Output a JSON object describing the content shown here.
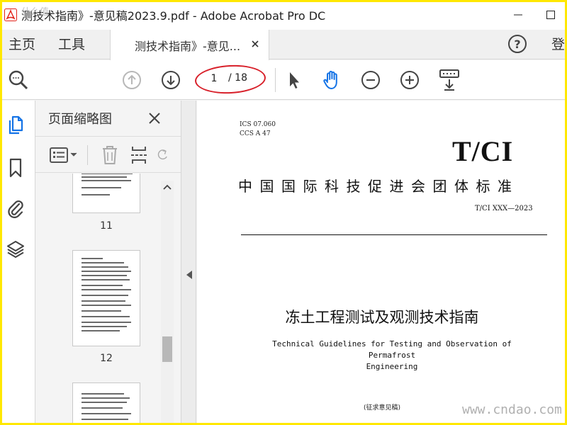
{
  "window": {
    "title": "测技术指南》-意见稿2023.9.pdf - Adobe Acrobat Pro DC",
    "corner_watermark": "什么值"
  },
  "tabs": {
    "home_label": "主页",
    "tools_label": "工具",
    "doc_tab_label": "测技术指南》-意见...",
    "login_label": "登"
  },
  "toolbar": {
    "page_current": "1",
    "page_total": "/ 18"
  },
  "thumbnail_panel": {
    "title": "页面缩略图",
    "pages": [
      {
        "number": "11"
      },
      {
        "number": "12"
      },
      {
        "number": ""
      }
    ]
  },
  "document": {
    "ics_line": "ICS  07.060",
    "ccs_line": "CCS A 47",
    "logo_text": "T/CI",
    "standard_type": "中国国际科技促进会团体标准",
    "standard_number": "T/CI XXX—2023",
    "title_cn": "冻土工程测试及观测技术指南",
    "title_en_line1": "Technical Guidelines for Testing and Observation of Permafrost",
    "title_en_line2": "Engineering",
    "draft_note": "(征求意见稿)"
  },
  "watermark": "www.cndao.com",
  "colors": {
    "annotation_red": "#d8202a",
    "hand_tool_blue": "#1473e6",
    "acrobat_red": "#e2231a",
    "highlight_frame": "#ffe800"
  },
  "icons": {
    "app": "acrobat-icon",
    "zoom": "zoom-marquee-icon",
    "prev_page": "arrow-up-circle-icon",
    "next_page": "arrow-down-circle-icon",
    "select": "arrow-pointer-icon",
    "hand": "hand-icon",
    "zoom_out": "zoom-out-icon",
    "zoom_in": "zoom-in-icon",
    "keyboard": "keyboard-icon"
  }
}
